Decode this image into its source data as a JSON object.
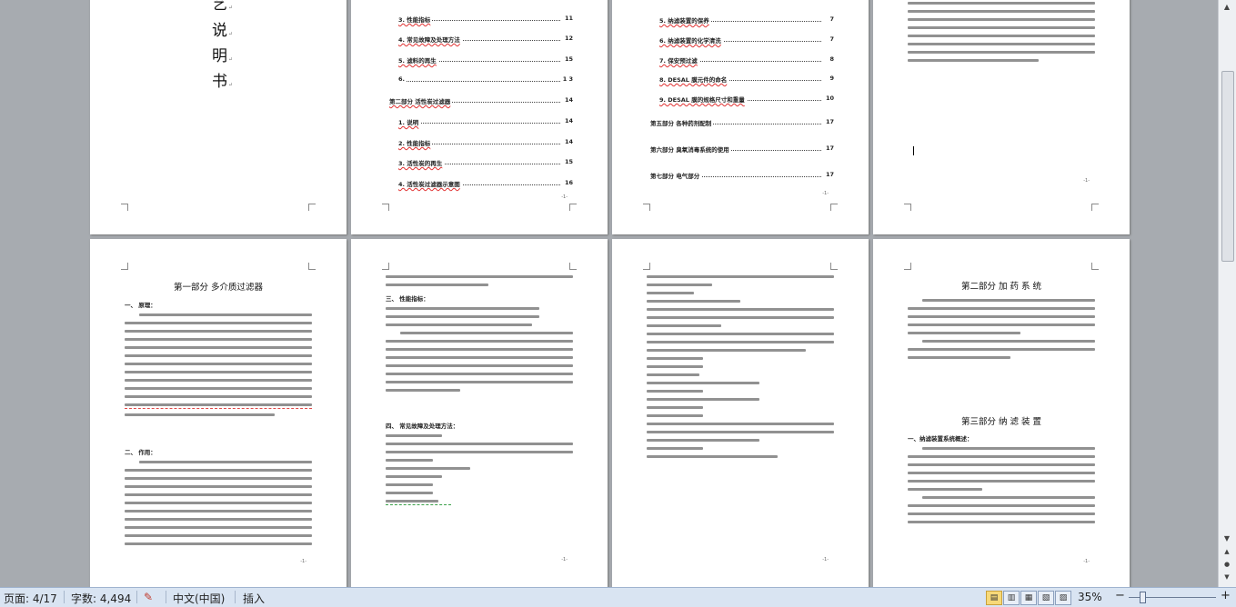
{
  "page1": {
    "chars": [
      "艺",
      "说",
      "明",
      "书"
    ],
    "mark": "↵"
  },
  "page2": {
    "toc": [
      {
        "label": "3. 性能指标",
        "page": "11",
        "sec": false,
        "wavy": true
      },
      {
        "label": "4. 常见故障及处理方法",
        "page": "12",
        "sec": false,
        "wavy": true
      },
      {
        "label": "5. 滤料的再生",
        "page": "15",
        "sec": false,
        "wavy": true
      },
      {
        "label": "6.",
        "page": "1 3",
        "sec": false,
        "wavy": false
      },
      {
        "label": "第二部分  活性炭过滤器",
        "page": "14",
        "sec": true,
        "wavy": true
      },
      {
        "label": "1. 说明",
        "page": "14",
        "sec": false,
        "wavy": true
      },
      {
        "label": "2. 性能指标",
        "page": "14",
        "sec": false,
        "wavy": true
      },
      {
        "label": "3. 活性炭的再生",
        "page": "15",
        "sec": false,
        "wavy": true
      },
      {
        "label": "4. 活性炭过滤器示意图",
        "page": "16",
        "sec": false,
        "wavy": true
      }
    ],
    "pnum": "-1-"
  },
  "page3": {
    "toc": [
      {
        "label": "5. 纳滤装置的保养",
        "page": "7",
        "sec": false,
        "wavy": true
      },
      {
        "label": "6. 纳滤装置的化学清洗",
        "page": "7",
        "sec": false,
        "wavy": true
      },
      {
        "label": "7. 保安预过滤",
        "page": "8",
        "sec": false,
        "wavy": true
      },
      {
        "label": "8. DESAL 膜元件的命名",
        "page": "9",
        "sec": false,
        "wavy": true
      },
      {
        "label": "9. DESAL 膜的规格尺寸和重量",
        "page": "10",
        "sec": false,
        "wavy": true
      },
      {
        "label": "第五部分  各种药剂配制",
        "page": "17",
        "sec": true,
        "wavy": false
      },
      {
        "label": "第六部分  臭氧消毒系统的使用",
        "page": "17",
        "sec": true,
        "wavy": false
      },
      {
        "label": "第七部分  电气部分",
        "page": "17",
        "sec": true,
        "wavy": false
      }
    ],
    "pnum": "-1-"
  },
  "page4": {
    "pnum": "-1-"
  },
  "page5": {
    "heading": "第一部分  多介质过滤器",
    "sub1": "一、 原理：",
    "sub2": "二、 作用：",
    "pnum": "-1-"
  },
  "page6": {
    "sub1": "三、 性能指标：",
    "sub2": "四、 常见故障及处理方法：",
    "pnum": "-1-"
  },
  "page7": {
    "pnum": "-1-"
  },
  "page8": {
    "heading1": "第二部分  加 药 系 统",
    "heading2": "第三部分  纳 滤 装 置",
    "sub1": "一、纳滤装置系统概述：",
    "pnum": "-1-"
  },
  "status": {
    "page": "页面: 4/17",
    "words": "字数: 4,494",
    "lang": "中文(中国)",
    "mode": "插入",
    "zoom": "35%",
    "minus": "−",
    "plus": "+",
    "views": [
      "▤",
      "▥",
      "▦",
      "▧",
      "▨"
    ]
  },
  "scroll": {
    "up": "▲",
    "down": "▼",
    "prev": "▲",
    "select": "●",
    "next": "▼"
  }
}
